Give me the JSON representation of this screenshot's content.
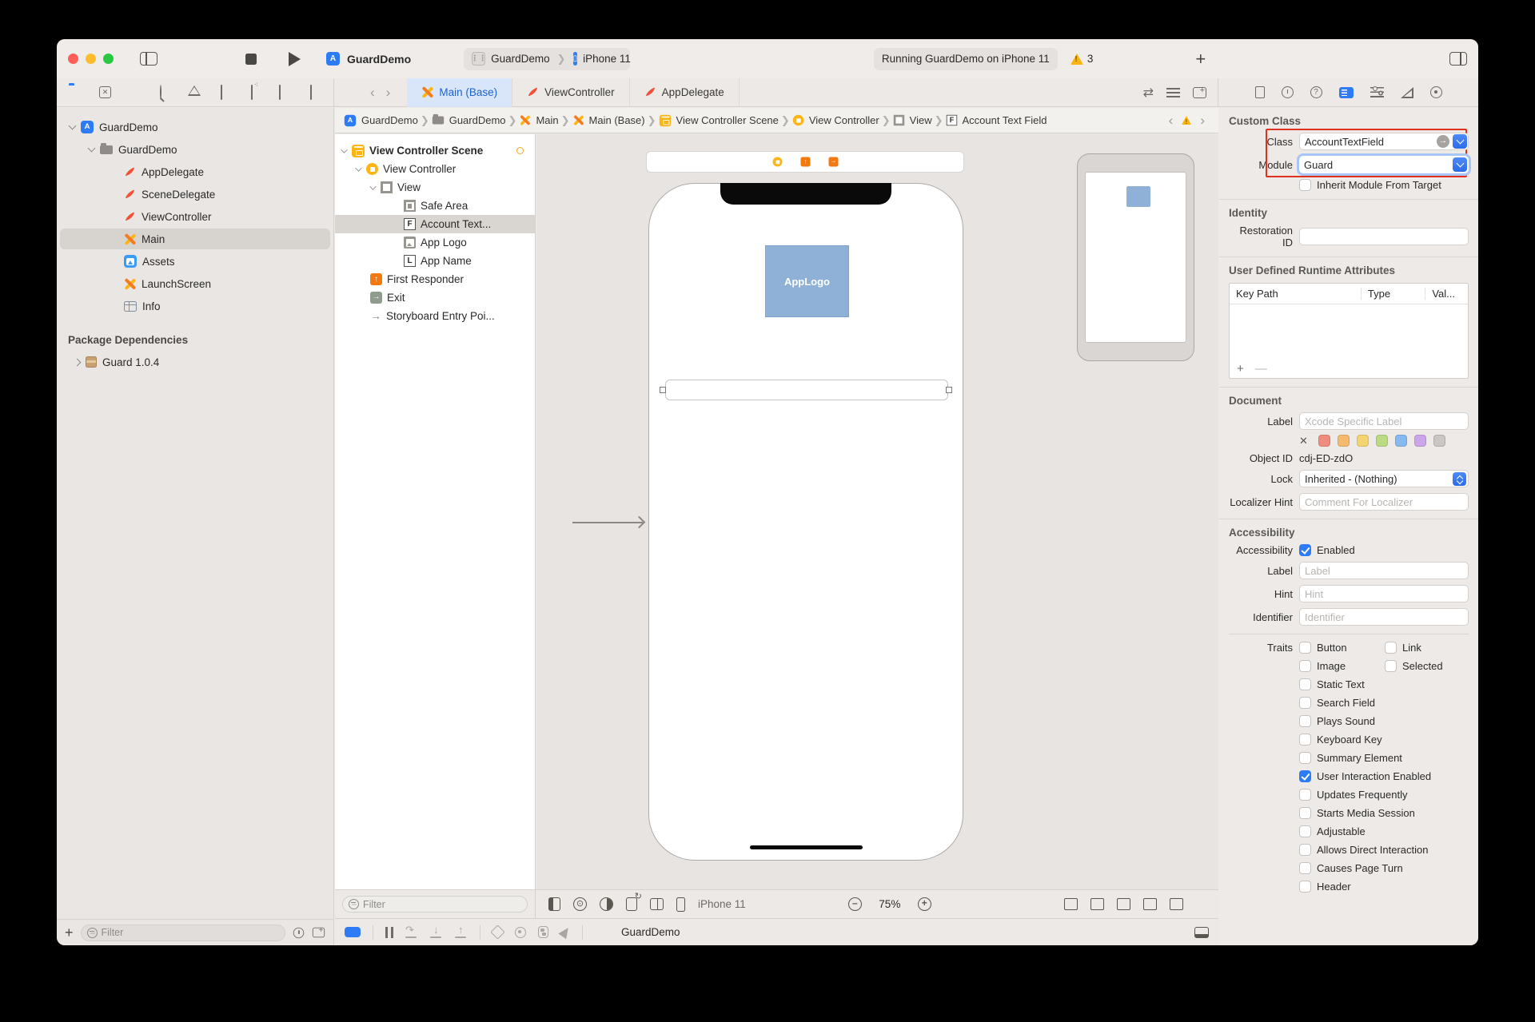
{
  "chrome": {
    "window_title": "GuardDemo",
    "scheme_app": "GuardDemo",
    "scheme_device": "iPhone 11",
    "status_text": "Running GuardDemo on iPhone 11",
    "warning_count": "3"
  },
  "navigator": {
    "filter_placeholder": "Filter",
    "items": [
      {
        "label": "GuardDemo"
      },
      {
        "label": "GuardDemo"
      },
      {
        "label": "AppDelegate"
      },
      {
        "label": "SceneDelegate"
      },
      {
        "label": "ViewController"
      },
      {
        "label": "Main"
      },
      {
        "label": "Assets"
      },
      {
        "label": "LaunchScreen"
      },
      {
        "label": "Info"
      }
    ],
    "package_header": "Package Dependencies",
    "package_item": "Guard 1.0.4"
  },
  "tabs": {
    "main": "Main (Base)",
    "viewcontroller": "ViewController",
    "appdelegate": "AppDelegate"
  },
  "jumpbar": {
    "items": [
      "GuardDemo",
      "GuardDemo",
      "Main",
      "Main (Base)",
      "View Controller Scene",
      "View Controller",
      "View",
      "Account Text Field"
    ]
  },
  "outline": {
    "filter_placeholder": "Filter",
    "items": [
      {
        "label": "View Controller Scene"
      },
      {
        "label": "View Controller"
      },
      {
        "label": "View"
      },
      {
        "label": "Safe Area"
      },
      {
        "label": "Account Text..."
      },
      {
        "label": "App Logo"
      },
      {
        "label": "App Name"
      },
      {
        "label": "First Responder"
      },
      {
        "label": "Exit"
      },
      {
        "label": "Storyboard Entry Poi..."
      }
    ]
  },
  "canvas": {
    "app_logo_text": "AppLogo",
    "device_label": "iPhone 11",
    "zoom_level": "75%"
  },
  "debugbar": {
    "app_label": "GuardDemo"
  },
  "inspector": {
    "custom_class": {
      "header": "Custom Class",
      "class_label": "Class",
      "class_value": "AccountTextField",
      "module_label": "Module",
      "module_value": "Guard",
      "inherit_label": "Inherit Module From Target"
    },
    "identity": {
      "header": "Identity",
      "restoration_label": "Restoration ID"
    },
    "runtime_attributes": {
      "header": "User Defined Runtime Attributes",
      "col_keypath": "Key Path",
      "col_type": "Type",
      "col_value": "Val..."
    },
    "document": {
      "header": "Document",
      "label_label": "Label",
      "label_placeholder": "Xcode Specific Label",
      "object_id_label": "Object ID",
      "object_id_value": "cdj-ED-zdO",
      "lock_label": "Lock",
      "lock_value": "Inherited - (Nothing)",
      "localizer_label": "Localizer Hint",
      "localizer_placeholder": "Comment For Localizer"
    },
    "accessibility": {
      "header": "Accessibility",
      "accessibility_label": "Accessibility",
      "enabled_label": "Enabled",
      "enabled_checked": true,
      "label_label": "Label",
      "label_placeholder": "Label",
      "hint_label": "Hint",
      "hint_placeholder": "Hint",
      "identifier_label": "Identifier",
      "identifier_placeholder": "Identifier",
      "traits_label": "Traits",
      "traits": [
        {
          "label": "Button",
          "checked": false
        },
        {
          "label": "Link",
          "checked": false
        },
        {
          "label": "Image",
          "checked": false
        },
        {
          "label": "Selected",
          "checked": false
        },
        {
          "label": "Static Text",
          "checked": false
        },
        {
          "label": "Search Field",
          "checked": false
        },
        {
          "label": "Plays Sound",
          "checked": false
        },
        {
          "label": "Keyboard Key",
          "checked": false
        },
        {
          "label": "Summary Element",
          "checked": false
        },
        {
          "label": "User Interaction Enabled",
          "checked": true
        },
        {
          "label": "Updates Frequently",
          "checked": false
        },
        {
          "label": "Starts Media Session",
          "checked": false
        },
        {
          "label": "Adjustable",
          "checked": false
        },
        {
          "label": "Causes Page Turn",
          "checked": false
        },
        {
          "label": "Allows Direct Interaction",
          "checked": false
        },
        {
          "label": "Header",
          "checked": false
        }
      ],
      "trait_order_note": "rows: [0,1],[2,3],4,5,6,7,8,9,10,11,12,14,13,15"
    },
    "colors": {
      "accent_blue": "#2D7CF6",
      "annotation_red": "#E0301E",
      "warning_yellow": "#F9B613",
      "swift_orange": "#F05138",
      "scene_yellow": "#FDB515"
    }
  }
}
